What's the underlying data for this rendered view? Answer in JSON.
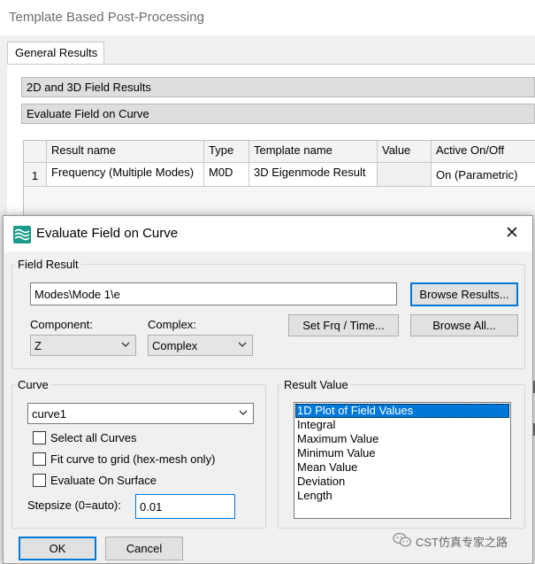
{
  "background_window": {
    "title": "Template Based Post-Processing",
    "tab_label": "General Results",
    "sections": [
      "2D and 3D Field Results",
      "Evaluate Field on Curve"
    ],
    "table": {
      "columns": [
        "Result name",
        "Type",
        "Template name",
        "Value",
        "Active On/Off"
      ],
      "rows": [
        {
          "num": "1",
          "result_name": "Frequency (Multiple Modes)",
          "type": "M0D",
          "template_name": "3D Eigenmode Result",
          "value": "",
          "active": "On (Parametric)"
        }
      ]
    }
  },
  "dialog": {
    "title": "Evaluate Field on Curve",
    "close_label": "✕",
    "field_result": {
      "legend": "Field Result",
      "path_value": "Modes\\Mode 1\\e",
      "browse_results_label": "Browse Results...",
      "set_frq_time_label": "Set Frq / Time...",
      "browse_all_label": "Browse All...",
      "component_label": "Component:",
      "component_value": "Z",
      "complex_label": "Complex:",
      "complex_value": "Complex"
    },
    "curve": {
      "legend": "Curve",
      "curve_value": "curve1",
      "select_all_curves": "Select all Curves",
      "fit_curve_to_grid": "Fit curve to grid (hex-mesh only)",
      "evaluate_on_surface": "Evaluate On Surface",
      "stepsize_label": "Stepsize (0=auto):",
      "stepsize_value": "0.01"
    },
    "result_value": {
      "legend": "Result Value",
      "items": [
        "1D Plot of Field Values",
        "Integral",
        "Maximum Value",
        "Minimum Value",
        "Mean Value",
        "Deviation",
        "Length"
      ],
      "selected_index": 0
    },
    "ok_label": "OK",
    "cancel_label": "Cancel"
  },
  "watermark": {
    "text": "CST仿真专家之路"
  },
  "colors": {
    "accent": "#0078d7",
    "dialog_bg": "#f0f0f0",
    "section_bar": "#dedede",
    "app_icon": "#1a9a8a"
  }
}
